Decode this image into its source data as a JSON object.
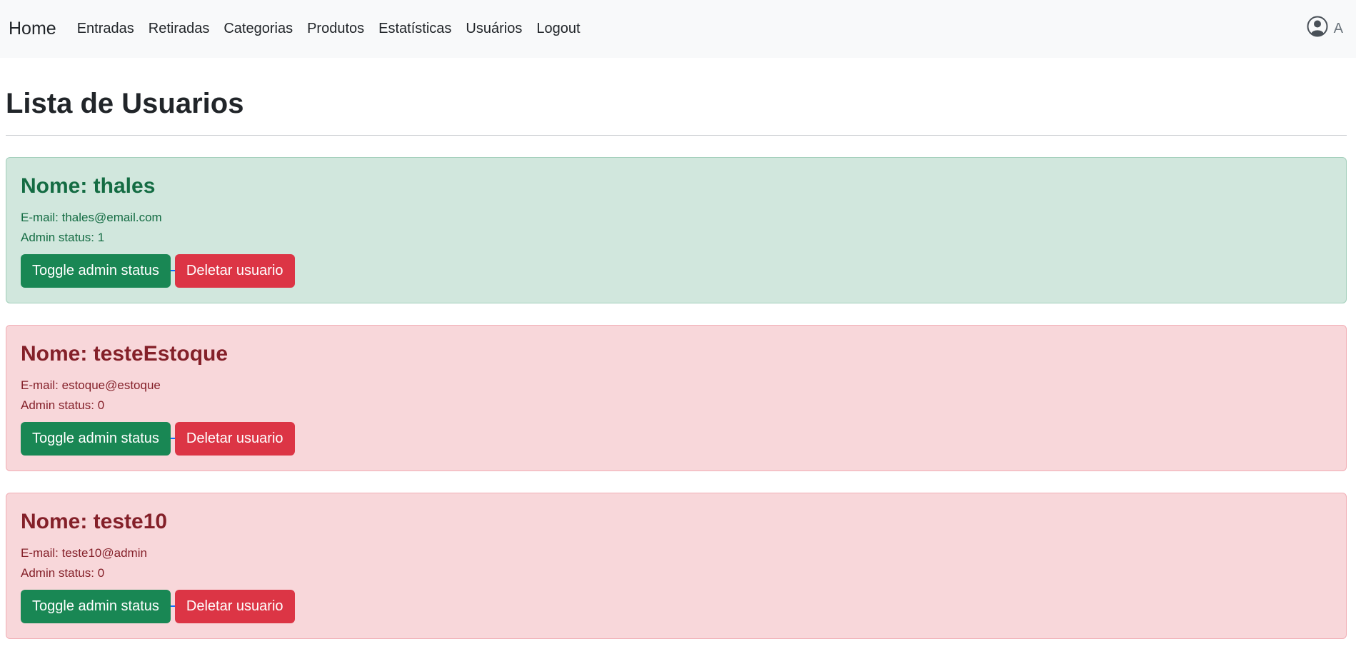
{
  "nav": {
    "brand": "Home",
    "links": [
      "Entradas",
      "Retiradas",
      "Categorias",
      "Produtos",
      "Estatísticas",
      "Usuários",
      "Logout"
    ],
    "user_initial": "A"
  },
  "page": {
    "title": "Lista de Usuarios"
  },
  "users": [
    {
      "name_line": "Nome: thales",
      "email_line": "E-mail: thales@email.com",
      "admin_line": "Admin status: 1",
      "toggle_label": "Toggle admin status",
      "delete_label": "Deletar usuario",
      "variant": "success"
    },
    {
      "name_line": "Nome: testeEstoque",
      "email_line": "E-mail: estoque@estoque",
      "admin_line": "Admin status: 0",
      "toggle_label": "Toggle admin status",
      "delete_label": "Deletar usuario",
      "variant": "danger"
    },
    {
      "name_line": "Nome: teste10",
      "email_line": "E-mail: teste10@admin",
      "admin_line": "Admin status: 0",
      "toggle_label": "Toggle admin status",
      "delete_label": "Deletar usuario",
      "variant": "danger"
    }
  ],
  "colors": {
    "success_bg": "#d1e7dd",
    "danger_bg": "#f8d7da",
    "success_button": "#198754",
    "danger_button": "#dc3545",
    "navbar_bg": "#f8f9fa"
  }
}
